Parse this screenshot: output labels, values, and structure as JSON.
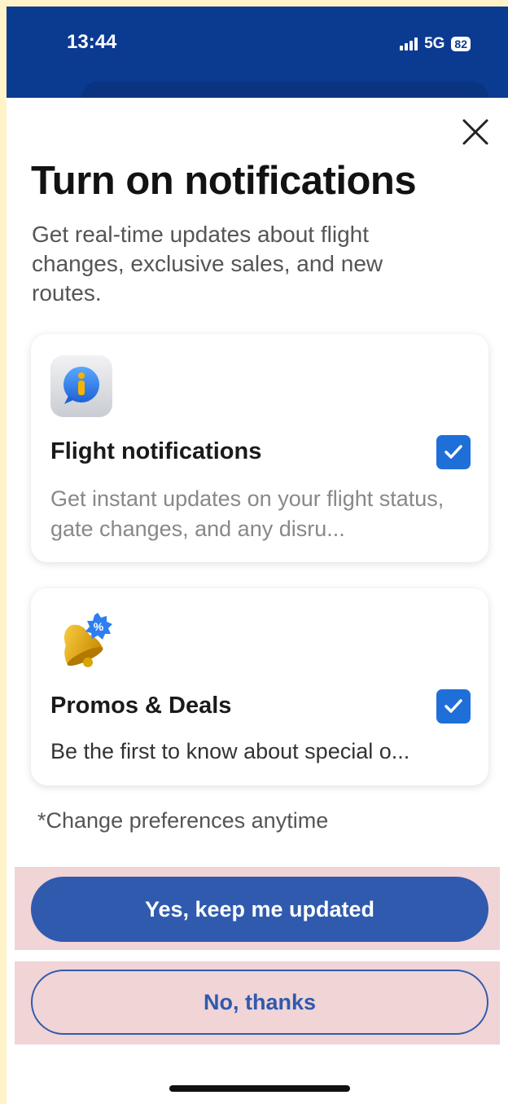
{
  "status": {
    "time": "13:44",
    "network": "5G",
    "battery": "82"
  },
  "modal": {
    "title": "Turn on notifications",
    "subtitle": "Get real-time updates about flight changes, exclusive sales, and new routes.",
    "options": [
      {
        "title": "Flight notifications",
        "description": "Get instant updates on your flight status, gate changes, and any disru...",
        "checked": true,
        "icon": "info-bubble-icon"
      },
      {
        "title": "Promos & Deals",
        "description": "Be the first to know about special o...",
        "checked": true,
        "icon": "bell-discount-icon"
      }
    ],
    "footnote": "*Change preferences anytime",
    "primary_button": "Yes, keep me updated",
    "secondary_button": "No, thanks"
  },
  "colors": {
    "header": "#0b3a91",
    "primary": "#2f5aae",
    "checkbox": "#1f6fd9",
    "highlight": "#f0d4d6"
  }
}
